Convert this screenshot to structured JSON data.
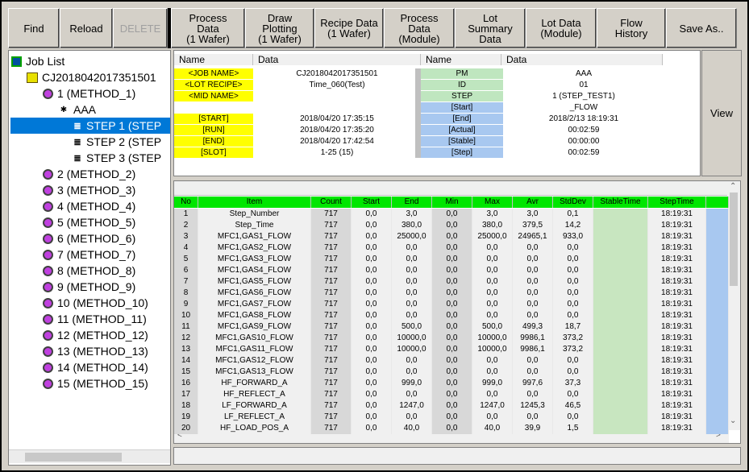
{
  "toolbar": {
    "find": "Find",
    "reload": "Reload",
    "delete": "DELETE",
    "process_data": "Process\nData\n(1 Wafer)",
    "draw_plotting": "Draw\nPlotting\n(1 Wafer)",
    "recipe_data": "Recipe Data\n(1 Wafer)",
    "process_data_module": "Process\nData\n(Module)",
    "lot_summary": "Lot\nSummary\nData",
    "lot_data_module": "Lot Data\n(Module)",
    "flow_history": "Flow\nHistory",
    "save_as": "Save As.."
  },
  "tree": {
    "root": "Job List",
    "lot": "CJ2018042017351501",
    "aaa": "AAA",
    "methods": [
      "1 (METHOD_1)",
      "2 (METHOD_2)",
      "3 (METHOD_3)",
      "4 (METHOD_4)",
      "5 (METHOD_5)",
      "6 (METHOD_6)",
      "7 (METHOD_7)",
      "8 (METHOD_8)",
      "9 (METHOD_9)",
      "10 (METHOD_10)",
      "11 (METHOD_11)",
      "12 (METHOD_12)",
      "13 (METHOD_13)",
      "14 (METHOD_14)",
      "15 (METHOD_15)"
    ],
    "steps": [
      "STEP 1 (STEP",
      "STEP 2 (STEP",
      "STEP 3 (STEP"
    ]
  },
  "info": {
    "header_name": "Name",
    "header_data": "Data",
    "left": [
      {
        "label": "<JOB NAME>",
        "value": "CJ2018042017351501"
      },
      {
        "label": "<LOT RECIPE>",
        "value": "Time_060(Test)"
      },
      {
        "label": "<MID NAME>",
        "value": ""
      },
      {
        "label": "",
        "value": ""
      },
      {
        "label": "[START]",
        "value": "2018/04/20 17:35:15"
      },
      {
        "label": "[RUN]",
        "value": "2018/04/20 17:35:20"
      },
      {
        "label": "[END]",
        "value": "2018/04/20 17:42:54"
      },
      {
        "label": "[SLOT]",
        "value": "1-25 (15)"
      }
    ],
    "right": [
      {
        "label": "PM",
        "value": "AAA"
      },
      {
        "label": "ID",
        "value": "01"
      },
      {
        "label": "STEP",
        "value": "1 (STEP_TEST1)"
      },
      {
        "label": "[Start]",
        "value": "_FLOW"
      },
      {
        "label": "[End]",
        "value": "2018/2/13 18:19:31"
      },
      {
        "label": "[Actual]",
        "value": "00:02:59"
      },
      {
        "label": "[Stable]",
        "value": "00:00:00"
      },
      {
        "label": "[Step]",
        "value": "00:02:59"
      }
    ]
  },
  "view_button": "View",
  "grid": {
    "columns": [
      "No",
      "Item",
      "Count",
      "Start",
      "End",
      "Min",
      "Max",
      "Avr",
      "StdDev",
      "StableTime",
      "StepTime"
    ],
    "rows": [
      [
        "1",
        "Step_Number",
        "717",
        "0,0",
        "3,0",
        "0,0",
        "3,0",
        "3,0",
        "0,1",
        "",
        "18:19:31"
      ],
      [
        "2",
        "Step_Time",
        "717",
        "0,0",
        "380,0",
        "0,0",
        "380,0",
        "379,5",
        "14,2",
        "",
        "18:19:31"
      ],
      [
        "3",
        "MFC1,GAS1_FLOW",
        "717",
        "0,0",
        "25000,0",
        "0,0",
        "25000,0",
        "24965,1",
        "933,0",
        "",
        "18:19:31"
      ],
      [
        "4",
        "MFC1,GAS2_FLOW",
        "717",
        "0,0",
        "0,0",
        "0,0",
        "0,0",
        "0,0",
        "0,0",
        "",
        "18:19:31"
      ],
      [
        "5",
        "MFC1,GAS3_FLOW",
        "717",
        "0,0",
        "0,0",
        "0,0",
        "0,0",
        "0,0",
        "0,0",
        "",
        "18:19:31"
      ],
      [
        "6",
        "MFC1,GAS4_FLOW",
        "717",
        "0,0",
        "0,0",
        "0,0",
        "0,0",
        "0,0",
        "0,0",
        "",
        "18:19:31"
      ],
      [
        "7",
        "MFC1,GAS5_FLOW",
        "717",
        "0,0",
        "0,0",
        "0,0",
        "0,0",
        "0,0",
        "0,0",
        "",
        "18:19:31"
      ],
      [
        "8",
        "MFC1,GAS6_FLOW",
        "717",
        "0,0",
        "0,0",
        "0,0",
        "0,0",
        "0,0",
        "0,0",
        "",
        "18:19:31"
      ],
      [
        "9",
        "MFC1,GAS7_FLOW",
        "717",
        "0,0",
        "0,0",
        "0,0",
        "0,0",
        "0,0",
        "0,0",
        "",
        "18:19:31"
      ],
      [
        "10",
        "MFC1,GAS8_FLOW",
        "717",
        "0,0",
        "0,0",
        "0,0",
        "0,0",
        "0,0",
        "0,0",
        "",
        "18:19:31"
      ],
      [
        "11",
        "MFC1,GAS9_FLOW",
        "717",
        "0,0",
        "500,0",
        "0,0",
        "500,0",
        "499,3",
        "18,7",
        "",
        "18:19:31"
      ],
      [
        "12",
        "MFC1,GAS10_FLOW",
        "717",
        "0,0",
        "10000,0",
        "0,0",
        "10000,0",
        "9986,1",
        "373,2",
        "",
        "18:19:31"
      ],
      [
        "13",
        "MFC1,GAS11_FLOW",
        "717",
        "0,0",
        "10000,0",
        "0,0",
        "10000,0",
        "9986,1",
        "373,2",
        "",
        "18:19:31"
      ],
      [
        "14",
        "MFC1,GAS12_FLOW",
        "717",
        "0,0",
        "0,0",
        "0,0",
        "0,0",
        "0,0",
        "0,0",
        "",
        "18:19:31"
      ],
      [
        "15",
        "MFC1,GAS13_FLOW",
        "717",
        "0,0",
        "0,0",
        "0,0",
        "0,0",
        "0,0",
        "0,0",
        "",
        "18:19:31"
      ],
      [
        "16",
        "HF_FORWARD_A",
        "717",
        "0,0",
        "999,0",
        "0,0",
        "999,0",
        "997,6",
        "37,3",
        "",
        "18:19:31"
      ],
      [
        "17",
        "HF_REFLECT_A",
        "717",
        "0,0",
        "0,0",
        "0,0",
        "0,0",
        "0,0",
        "0,0",
        "",
        "18:19:31"
      ],
      [
        "18",
        "LF_FORWARD_A",
        "717",
        "0,0",
        "1247,0",
        "0,0",
        "1247,0",
        "1245,3",
        "46,5",
        "",
        "18:19:31"
      ],
      [
        "19",
        "LF_REFLECT_A",
        "717",
        "0,0",
        "0,0",
        "0,0",
        "0,0",
        "0,0",
        "0,0",
        "",
        "18:19:31"
      ],
      [
        "20",
        "HF_LOAD_POS_A",
        "717",
        "0,0",
        "40,0",
        "0,0",
        "40,0",
        "39,9",
        "1,5",
        "",
        "18:19:31"
      ]
    ]
  },
  "colors": {
    "header_green": "#00e600",
    "label_yellow": "#ffff00",
    "selection": "#0078d7",
    "stable_green": "#c8e6c0",
    "step_blue": "#a8c8f0"
  }
}
